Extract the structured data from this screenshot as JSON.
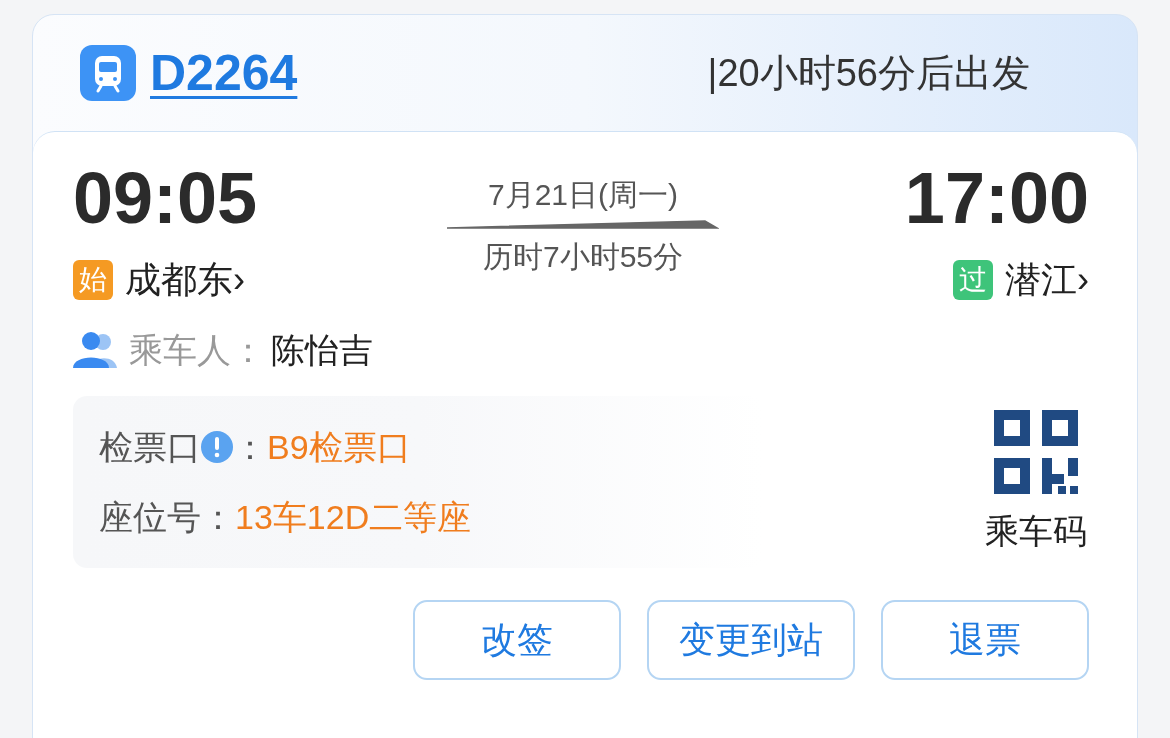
{
  "train": {
    "number": "D2264",
    "countdown": "|20小时56分后出发"
  },
  "departure": {
    "time": "09:05",
    "badge": {
      "text": "始",
      "color": "#f59a23"
    },
    "station": "成都东",
    "chevron": "›"
  },
  "journey": {
    "date": "7月21日(周一)",
    "duration": "历时7小时55分"
  },
  "arrival": {
    "time": "17:00",
    "badge": {
      "text": "过",
      "color": "#3ec47a"
    },
    "station": "潜江",
    "chevron": "›"
  },
  "passenger": {
    "label": "乘车人：",
    "name": "陈怡吉"
  },
  "info_rows": [
    {
      "kind": "info",
      "label": "检票口",
      "colon": "：",
      "value": "B9检票口"
    },
    {
      "kind": "plain",
      "label": "座位号：",
      "value": "13车12D二等座"
    }
  ],
  "qr": {
    "label": "乘车码"
  },
  "buttons": [
    "改签",
    "变更到站",
    "退票"
  ]
}
